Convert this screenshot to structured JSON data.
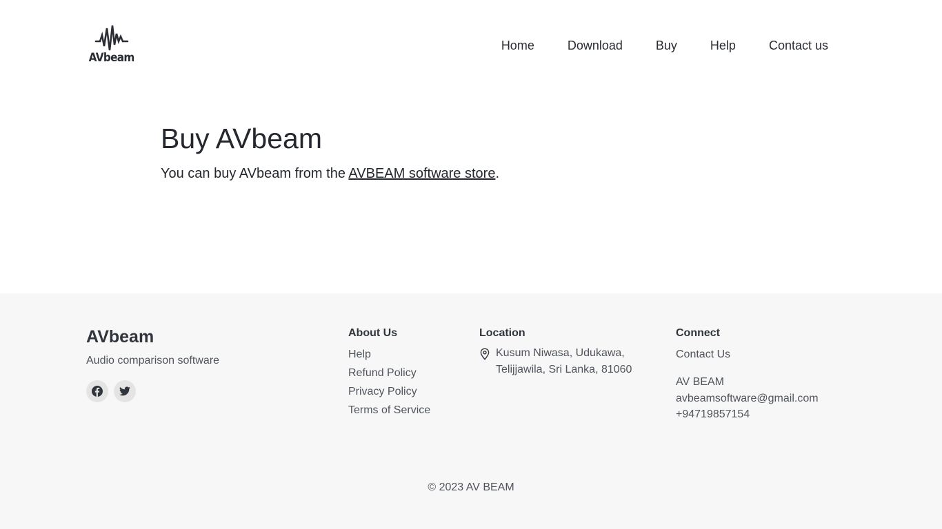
{
  "header": {
    "logo_text": "AVbeam",
    "nav": {
      "home": "Home",
      "download": "Download",
      "buy": "Buy",
      "help": "Help",
      "contact": "Contact us"
    }
  },
  "main": {
    "title": "Buy AVbeam",
    "lead_prefix": "You can buy AVbeam from the ",
    "store_link": "AVBEAM software store",
    "lead_suffix": "."
  },
  "footer": {
    "brand_name": "AVbeam",
    "tagline": "Audio comparison software",
    "socials": [
      "facebook-icon",
      "twitter-icon"
    ],
    "about": {
      "title": "About Us",
      "links": [
        "Help",
        "Refund Policy",
        "Privacy Policy",
        "Terms of Service"
      ]
    },
    "location": {
      "title": "Location",
      "line1": "Kusum Niwasa, Udukawa,",
      "line2": "Telijjawila, Sri Lanka, 81060"
    },
    "connect": {
      "title": "Connect",
      "contact_link": "Contact Us",
      "company": "AV BEAM",
      "email": "avbeamsoftware@gmail.com",
      "phone": "+94719857154"
    },
    "copyright": "© 2023 AV BEAM"
  },
  "colors": {
    "text": "#2a2d34",
    "footer_bg": "#f7f7f7",
    "social_bg": "#e4e4e4"
  }
}
